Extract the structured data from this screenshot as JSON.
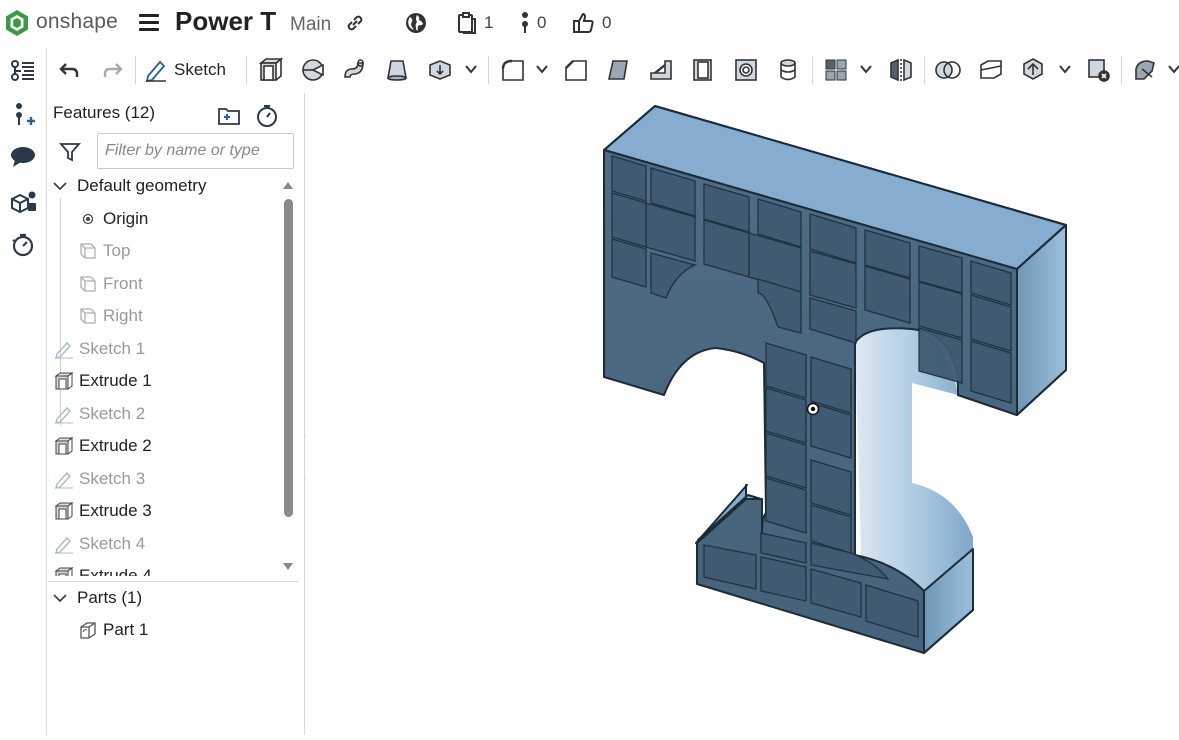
{
  "app": {
    "brand": "onshape",
    "document_title": "Power T",
    "workspace": "Main",
    "versions_count": "1",
    "branches_count": "0",
    "likes_count": "0"
  },
  "toolbar": {
    "sketch_label": "Sketch"
  },
  "features_panel": {
    "title": "Features (12)",
    "filter_placeholder": "Filter by name or type",
    "default_geometry": "Default geometry",
    "items": [
      {
        "label": "Origin",
        "icon": "origin-icon",
        "state": "normal"
      },
      {
        "label": "Top",
        "icon": "plane-icon",
        "state": "hidden"
      },
      {
        "label": "Front",
        "icon": "plane-icon",
        "state": "hidden"
      },
      {
        "label": "Right",
        "icon": "plane-icon",
        "state": "hidden"
      },
      {
        "label": "Sketch 1",
        "icon": "sketch-icon",
        "state": "hidden"
      },
      {
        "label": "Extrude 1",
        "icon": "extrude-icon",
        "state": "normal"
      },
      {
        "label": "Sketch 2",
        "icon": "sketch-icon",
        "state": "hidden"
      },
      {
        "label": "Extrude 2",
        "icon": "extrude-icon",
        "state": "normal"
      },
      {
        "label": "Sketch 3",
        "icon": "sketch-icon",
        "state": "hidden"
      },
      {
        "label": "Extrude 3",
        "icon": "extrude-icon",
        "state": "normal"
      },
      {
        "label": "Sketch 4",
        "icon": "sketch-icon",
        "state": "hidden"
      },
      {
        "label": "Extrude 4",
        "icon": "extrude-icon",
        "state": "normal"
      }
    ],
    "parts_header": "Parts (1)",
    "parts": [
      {
        "label": "Part 1",
        "icon": "part-icon"
      }
    ]
  },
  "colors": {
    "part_face": "#7fa7c8",
    "part_front": "#4d6a83",
    "part_edge": "#1c2b38",
    "accent": "#2f8a3e"
  }
}
